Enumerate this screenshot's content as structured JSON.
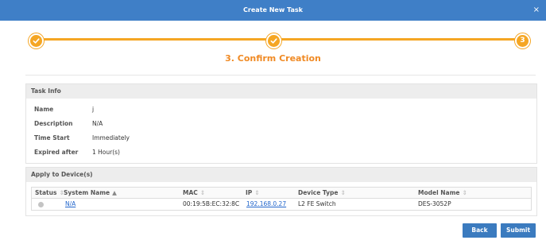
{
  "dialog": {
    "title": "Create New Task",
    "close_glyph": "×"
  },
  "wizard": {
    "accent_color": "#f5a623",
    "steps": [
      {
        "state": "done",
        "icon": "check-icon"
      },
      {
        "state": "done",
        "icon": "check-icon"
      },
      {
        "state": "current",
        "number": "3"
      }
    ],
    "current_title": "3. Confirm Creation"
  },
  "task_info": {
    "header": "Task Info",
    "rows": [
      {
        "label": "Name",
        "value": "j"
      },
      {
        "label": "Description",
        "value": "N/A"
      },
      {
        "label": "Time Start",
        "value": "Immediately"
      },
      {
        "label": "Expired after",
        "value": "1 Hour(s)"
      }
    ]
  },
  "devices": {
    "header": "Apply to Device(s)",
    "columns": {
      "status": "Status",
      "system_name": "System Name",
      "mac": "MAC",
      "ip": "IP",
      "device_type": "Device Type",
      "model_name": "Model Name"
    },
    "rows": [
      {
        "status": "offline",
        "system_name": "N/A",
        "mac": "00:19:5B:EC:32:8C",
        "ip": "192.168.0.27",
        "device_type": "L2 FE Switch",
        "model_name": "DES-3052P"
      }
    ]
  },
  "buttons": {
    "back": "Back",
    "submit": "Submit"
  },
  "colors": {
    "titlebar": "#3f7fc7",
    "accent": "#f5a623",
    "step_title": "#f08a24",
    "button": "#3b7bbf",
    "link": "#2266cc"
  }
}
